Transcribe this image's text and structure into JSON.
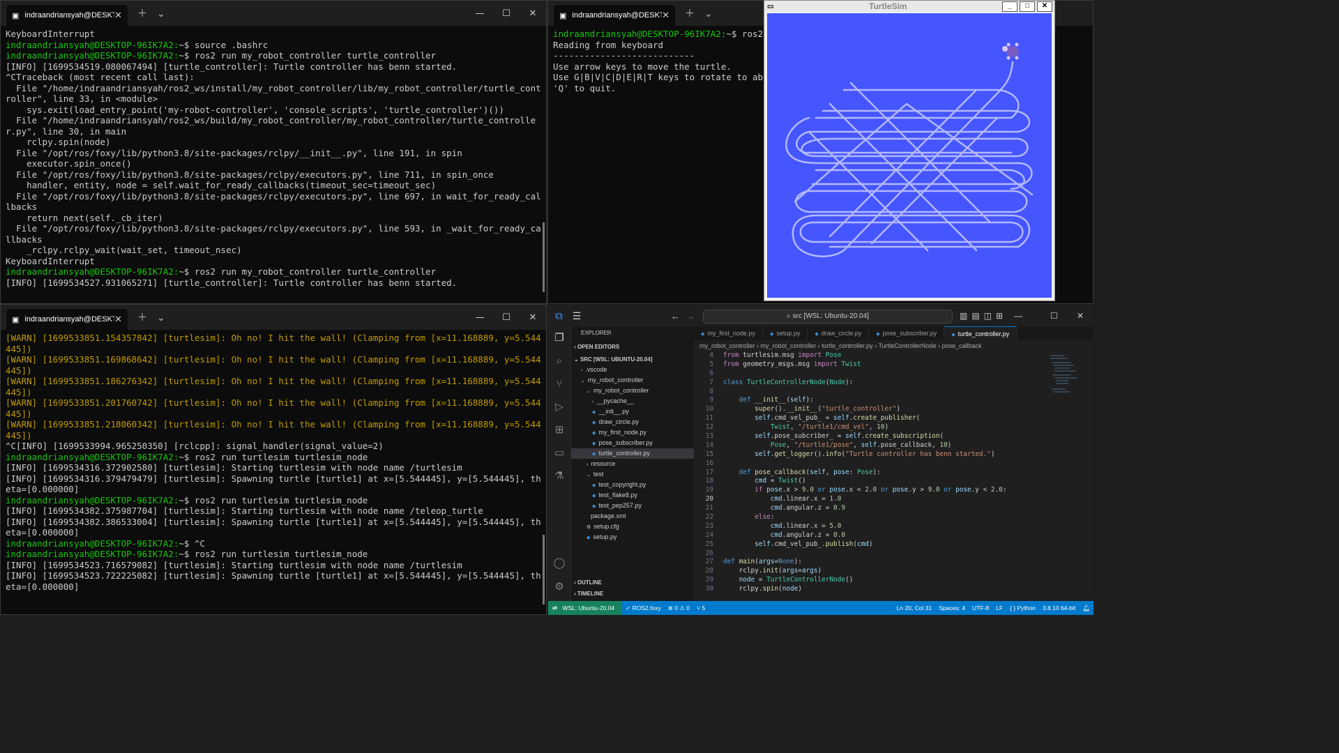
{
  "term_tl": {
    "tab_title": "indraandriansyah@DESKTOP-",
    "lines": [
      {
        "t": "KeyboardInterrupt",
        "c": "w"
      },
      {
        "parts": [
          {
            "t": "indraandriansyah@DESKTOP-96IK7A2:",
            "c": "g"
          },
          {
            "t": "~$ source .bashrc",
            "c": "w"
          }
        ]
      },
      {
        "parts": [
          {
            "t": "indraandriansyah@DESKTOP-96IK7A2:",
            "c": "g"
          },
          {
            "t": "~$ ros2 run my_robot_controller turtle_controller",
            "c": "w"
          }
        ]
      },
      {
        "t": "[INFO] [1699534519.080067494] [turtle_controller]: Turtle controller has benn started.",
        "c": "w"
      },
      {
        "t": "^CTraceback (most recent call last):",
        "c": "w"
      },
      {
        "t": "  File \"/home/indraandriansyah/ros2_ws/install/my_robot_controller/lib/my_robot_controller/turtle_controller\", line 33, in <module>",
        "c": "w"
      },
      {
        "t": "    sys.exit(load_entry_point('my-robot-controller', 'console_scripts', 'turtle_controller')())",
        "c": "w"
      },
      {
        "t": "  File \"/home/indraandriansyah/ros2_ws/build/my_robot_controller/my_robot_controller/turtle_controller.py\", line 30, in main",
        "c": "w"
      },
      {
        "t": "    rclpy.spin(node)",
        "c": "w"
      },
      {
        "t": "  File \"/opt/ros/foxy/lib/python3.8/site-packages/rclpy/__init__.py\", line 191, in spin",
        "c": "w"
      },
      {
        "t": "    executor.spin_once()",
        "c": "w"
      },
      {
        "t": "  File \"/opt/ros/foxy/lib/python3.8/site-packages/rclpy/executors.py\", line 711, in spin_once",
        "c": "w"
      },
      {
        "t": "    handler, entity, node = self.wait_for_ready_callbacks(timeout_sec=timeout_sec)",
        "c": "w"
      },
      {
        "t": "  File \"/opt/ros/foxy/lib/python3.8/site-packages/rclpy/executors.py\", line 697, in wait_for_ready_callbacks",
        "c": "w"
      },
      {
        "t": "    return next(self._cb_iter)",
        "c": "w"
      },
      {
        "t": "  File \"/opt/ros/foxy/lib/python3.8/site-packages/rclpy/executors.py\", line 593, in _wait_for_ready_callbacks",
        "c": "w"
      },
      {
        "t": "    _rclpy.rclpy_wait(wait_set, timeout_nsec)",
        "c": "w"
      },
      {
        "t": "KeyboardInterrupt",
        "c": "w"
      },
      {
        "parts": [
          {
            "t": "indraandriansyah@DESKTOP-96IK7A2:",
            "c": "g"
          },
          {
            "t": "~$ ros2 run my_robot_controller turtle_controller",
            "c": "w"
          }
        ]
      },
      {
        "t": "[INFO] [1699534527.931065271] [turtle_controller]: Turtle controller has benn started.",
        "c": "w"
      }
    ]
  },
  "term_tr": {
    "tab_title": "indraandriansyah@DESKTOP-",
    "lines": [
      {
        "parts": [
          {
            "t": "indraandriansyah@DESKTOP-96IK7A2:",
            "c": "g"
          },
          {
            "t": "~$ ros2 r",
            "c": "w"
          }
        ]
      },
      {
        "t": "Reading from keyboard",
        "c": "w"
      },
      {
        "t": "---------------------------",
        "c": "w"
      },
      {
        "t": "Use arrow keys to move the turtle.",
        "c": "w"
      },
      {
        "t": "Use G|B|V|C|D|E|R|T keys to rotate to abso",
        "c": "w"
      },
      {
        "t": "'Q' to quit.",
        "c": "w"
      }
    ]
  },
  "term_bl": {
    "tab_title": "indraandriansyah@DESKTOP-",
    "lines": [
      {
        "t": "[WARN] [1699533851.154357842] [turtlesim]: Oh no! I hit the wall! (Clamping from [x=11.168889, y=5.544445])",
        "c": "y"
      },
      {
        "t": "[WARN] [1699533851.169868642] [turtlesim]: Oh no! I hit the wall! (Clamping from [x=11.168889, y=5.544445])",
        "c": "y"
      },
      {
        "t": "[WARN] [1699533851.186276342] [turtlesim]: Oh no! I hit the wall! (Clamping from [x=11.168889, y=5.544445])",
        "c": "y"
      },
      {
        "t": "[WARN] [1699533851.201760742] [turtlesim]: Oh no! I hit the wall! (Clamping from [x=11.168889, y=5.544445])",
        "c": "y"
      },
      {
        "t": "[WARN] [1699533851.218060342] [turtlesim]: Oh no! I hit the wall! (Clamping from [x=11.168889, y=5.544445])",
        "c": "y"
      },
      {
        "t": "^C[INFO] [1699533994.965250350] [rclcpp]: signal_handler(signal_value=2)",
        "c": "w"
      },
      {
        "parts": [
          {
            "t": "indraandriansyah@DESKTOP-96IK7A2:",
            "c": "g"
          },
          {
            "t": "~$ ros2 run turtlesim turtlesim_node",
            "c": "w"
          }
        ]
      },
      {
        "t": "[INFO] [1699534316.372902580] [turtlesim]: Starting turtlesim with node name /turtlesim",
        "c": "w"
      },
      {
        "t": "[INFO] [1699534316.379479479] [turtlesim]: Spawning turtle [turtle1] at x=[5.544445], y=[5.544445], theta=[0.000000]",
        "c": "w"
      },
      {
        "parts": [
          {
            "t": "indraandriansyah@DESKTOP-96IK7A2:",
            "c": "g"
          },
          {
            "t": "~$ ros2 run turtlesim turtlesim_node",
            "c": "w"
          }
        ]
      },
      {
        "t": "[INFO] [1699534382.375987704] [turtlesim]: Starting turtlesim with node name /teleop_turtle",
        "c": "w"
      },
      {
        "t": "[INFO] [1699534382.386533004] [turtlesim]: Spawning turtle [turtle1] at x=[5.544445], y=[5.544445], theta=[0.000000]",
        "c": "w"
      },
      {
        "parts": [
          {
            "t": "indraandriansyah@DESKTOP-96IK7A2:",
            "c": "g"
          },
          {
            "t": "~$ ^C",
            "c": "w"
          }
        ]
      },
      {
        "parts": [
          {
            "t": "indraandriansyah@DESKTOP-96IK7A2:",
            "c": "g"
          },
          {
            "t": "~$ ros2 run turtlesim turtlesim_node",
            "c": "w"
          }
        ]
      },
      {
        "t": "[INFO] [1699534523.716579082] [turtlesim]: Starting turtlesim with node name /turtlesim",
        "c": "w"
      },
      {
        "t": "[INFO] [1699534523.722225082] [turtlesim]: Spawning turtle [turtle1] at x=[5.544445], y=[5.544445], theta=[0.000000]",
        "c": "w"
      }
    ]
  },
  "turtlesim": {
    "title": "TurtleSim",
    "bg_color": "#4556ff",
    "path_color": "#b3b8ff"
  },
  "vscode": {
    "search": "src [WSL: Ubuntu-20.04]",
    "explorer_title": "EXPLORER",
    "open_editors": "OPEN EDITORS",
    "root": "SRC [WSL: UBUNTU-20.04]",
    "tree": [
      {
        "label": ".vscode",
        "indent": 1,
        "icon": "›"
      },
      {
        "label": "my_robot_controller",
        "indent": 1,
        "icon": "⌄"
      },
      {
        "label": "my_robot_controller",
        "indent": 2,
        "icon": "⌄"
      },
      {
        "label": "__pycache__",
        "indent": 3,
        "icon": "›"
      },
      {
        "label": "__init__.py",
        "indent": 3,
        "icon": "◆"
      },
      {
        "label": "draw_circle.py",
        "indent": 3,
        "icon": "◆"
      },
      {
        "label": "my_first_node.py",
        "indent": 3,
        "icon": "◆"
      },
      {
        "label": "pose_subscriber.py",
        "indent": 3,
        "icon": "◆"
      },
      {
        "label": "turtle_controller.py",
        "indent": 3,
        "icon": "◆",
        "selected": true
      },
      {
        "label": "resource",
        "indent": 2,
        "icon": "›"
      },
      {
        "label": "test",
        "indent": 2,
        "icon": "⌄"
      },
      {
        "label": "test_copyright.py",
        "indent": 3,
        "icon": "◆"
      },
      {
        "label": "test_flake8.py",
        "indent": 3,
        "icon": "◆"
      },
      {
        "label": "test_pep257.py",
        "indent": 3,
        "icon": "◆"
      },
      {
        "label": "package.xml",
        "indent": 2,
        "icon": " "
      },
      {
        "label": "setup.cfg",
        "indent": 2,
        "icon": "⚙"
      },
      {
        "label": "setup.py",
        "indent": 2,
        "icon": "◆"
      }
    ],
    "outline": "OUTLINE",
    "timeline": "TIMELINE",
    "tabs": [
      {
        "label": "my_first_node.py"
      },
      {
        "label": "setup.py"
      },
      {
        "label": "draw_circle.py"
      },
      {
        "label": "pose_subscriber.py"
      },
      {
        "label": "turtle_controller.py",
        "active": true
      }
    ],
    "breadcrumbs": "my_robot_controller › my_robot_controller › turtle_controller.py › TurtleControllerNode › pose_callback",
    "code": [
      {
        "n": "4",
        "s": [
          [
            "from ",
            "kc"
          ],
          [
            "turtlesim.msg ",
            "pl"
          ],
          [
            "import ",
            "kc"
          ],
          [
            "Pose",
            "cls"
          ]
        ]
      },
      {
        "n": "5",
        "s": [
          [
            "from ",
            "kc"
          ],
          [
            "geometry_msgs.msg ",
            "pl"
          ],
          [
            "import ",
            "kc"
          ],
          [
            "Twist",
            "cls"
          ]
        ]
      },
      {
        "n": "6",
        "s": []
      },
      {
        "n": "7",
        "s": [
          [
            "class ",
            "kw"
          ],
          [
            "TurtleControllerNode",
            "cls"
          ],
          [
            "(",
            "pl"
          ],
          [
            "Node",
            "cls"
          ],
          [
            "):",
            "pl"
          ]
        ]
      },
      {
        "n": "8",
        "s": []
      },
      {
        "n": "9",
        "s": [
          [
            "    def ",
            "kw"
          ],
          [
            "__init__",
            "fn"
          ],
          [
            "(",
            "pl"
          ],
          [
            "self",
            "vr"
          ],
          [
            "):",
            "pl"
          ]
        ]
      },
      {
        "n": "10",
        "s": [
          [
            "        super",
            "fn"
          ],
          [
            "().",
            "pl"
          ],
          [
            "__init__",
            "fn"
          ],
          [
            "(",
            "pl"
          ],
          [
            "\"turtle_controller\"",
            "st"
          ],
          [
            ")",
            "pl"
          ]
        ]
      },
      {
        "n": "11",
        "s": [
          [
            "        self",
            "vr"
          ],
          [
            ".cmd_vel_pub_ = ",
            "pl"
          ],
          [
            "self",
            "vr"
          ],
          [
            ".",
            "pl"
          ],
          [
            "create_publisher",
            "fn"
          ],
          [
            "(",
            "pl"
          ]
        ]
      },
      {
        "n": "12",
        "s": [
          [
            "            Twist",
            "cls"
          ],
          [
            ", ",
            "pl"
          ],
          [
            "\"/turtle1/cmd_vel\"",
            "st"
          ],
          [
            ", ",
            "pl"
          ],
          [
            "10",
            "nm"
          ],
          [
            ")",
            "pl"
          ]
        ]
      },
      {
        "n": "13",
        "s": [
          [
            "        self",
            "vr"
          ],
          [
            ".pose_subcriber_ = ",
            "pl"
          ],
          [
            "self",
            "vr"
          ],
          [
            ".",
            "pl"
          ],
          [
            "create_subscription",
            "fn"
          ],
          [
            "(",
            "pl"
          ]
        ]
      },
      {
        "n": "14",
        "s": [
          [
            "            Pose",
            "cls"
          ],
          [
            ", ",
            "pl"
          ],
          [
            "\"/turtle1/pose\"",
            "st"
          ],
          [
            ", ",
            "pl"
          ],
          [
            "self",
            "vr"
          ],
          [
            ".pose_callback, ",
            "pl"
          ],
          [
            "10",
            "nm"
          ],
          [
            ")",
            "pl"
          ]
        ]
      },
      {
        "n": "15",
        "s": [
          [
            "        self",
            "vr"
          ],
          [
            ".",
            "pl"
          ],
          [
            "get_logger",
            "fn"
          ],
          [
            "().",
            "pl"
          ],
          [
            "info",
            "fn"
          ],
          [
            "(",
            "pl"
          ],
          [
            "\"Turtle controller has benn started.\"",
            "st"
          ],
          [
            ")",
            "pl"
          ]
        ]
      },
      {
        "n": "16",
        "s": []
      },
      {
        "n": "17",
        "s": [
          [
            "    def ",
            "kw"
          ],
          [
            "pose_callback",
            "fn"
          ],
          [
            "(",
            "pl"
          ],
          [
            "self",
            "vr"
          ],
          [
            ", ",
            "pl"
          ],
          [
            "pose",
            "vr"
          ],
          [
            ": ",
            "pl"
          ],
          [
            "Pose",
            "cls"
          ],
          [
            "):",
            "pl"
          ]
        ]
      },
      {
        "n": "18",
        "s": [
          [
            "        cmd",
            "vr"
          ],
          [
            " = ",
            "pl"
          ],
          [
            "Twist",
            "cls"
          ],
          [
            "()",
            "pl"
          ]
        ]
      },
      {
        "n": "19",
        "s": [
          [
            "        if ",
            "kc"
          ],
          [
            "pose",
            "vr"
          ],
          [
            ".x > ",
            "pl"
          ],
          [
            "9.0",
            "nm"
          ],
          [
            " or ",
            "kw"
          ],
          [
            "pose",
            "vr"
          ],
          [
            ".x < ",
            "pl"
          ],
          [
            "2.0",
            "nm"
          ],
          [
            " or ",
            "kw"
          ],
          [
            "pose",
            "vr"
          ],
          [
            ".y > ",
            "pl"
          ],
          [
            "9.0",
            "nm"
          ],
          [
            " or ",
            "kw"
          ],
          [
            "pose",
            "vr"
          ],
          [
            ".y < ",
            "pl"
          ],
          [
            "2.0",
            "nm"
          ],
          [
            ":",
            "pl"
          ]
        ]
      },
      {
        "n": "20",
        "s": [
          [
            "            cmd",
            "vr"
          ],
          [
            ".linear.x = ",
            "pl"
          ],
          [
            "1.0",
            "nm"
          ]
        ]
      },
      {
        "n": "21",
        "s": [
          [
            "            cmd",
            "vr"
          ],
          [
            ".angular.z = ",
            "pl"
          ],
          [
            "0.9",
            "nm"
          ]
        ]
      },
      {
        "n": "22",
        "s": [
          [
            "        else",
            "kc"
          ],
          [
            ":",
            "pl"
          ]
        ]
      },
      {
        "n": "23",
        "s": [
          [
            "            cmd",
            "vr"
          ],
          [
            ".linear.x = ",
            "pl"
          ],
          [
            "5.0",
            "nm"
          ]
        ]
      },
      {
        "n": "24",
        "s": [
          [
            "            cmd",
            "vr"
          ],
          [
            ".angular.z = ",
            "pl"
          ],
          [
            "0.0",
            "nm"
          ]
        ]
      },
      {
        "n": "25",
        "s": [
          [
            "        self",
            "vr"
          ],
          [
            ".cmd_vel_pub_.",
            "pl"
          ],
          [
            "publish",
            "fn"
          ],
          [
            "(",
            "pl"
          ],
          [
            "cmd",
            "vr"
          ],
          [
            ")",
            "pl"
          ]
        ]
      },
      {
        "n": "26",
        "s": []
      },
      {
        "n": "27",
        "s": [
          [
            "def ",
            "kw"
          ],
          [
            "main",
            "fn"
          ],
          [
            "(",
            "pl"
          ],
          [
            "args",
            "vr"
          ],
          [
            "=",
            "pl"
          ],
          [
            "None",
            "kw"
          ],
          [
            "):",
            "pl"
          ]
        ]
      },
      {
        "n": "28",
        "s": [
          [
            "    rclpy",
            "pl"
          ],
          [
            ".",
            "pl"
          ],
          [
            "init",
            "fn"
          ],
          [
            "(",
            "pl"
          ],
          [
            "args",
            "vr"
          ],
          [
            "=",
            "pl"
          ],
          [
            "args",
            "vr"
          ],
          [
            ")",
            "pl"
          ]
        ]
      },
      {
        "n": "29",
        "s": [
          [
            "    node",
            "vr"
          ],
          [
            " = ",
            "pl"
          ],
          [
            "TurtleControllerNode",
            "cls"
          ],
          [
            "()",
            "pl"
          ]
        ]
      },
      {
        "n": "30",
        "s": [
          [
            "    rclpy",
            "pl"
          ],
          [
            ".",
            "pl"
          ],
          [
            "spin",
            "fn"
          ],
          [
            "(",
            "pl"
          ],
          [
            "node",
            "vr"
          ],
          [
            ")",
            "pl"
          ]
        ]
      }
    ],
    "status": {
      "remote": "WSL: Ubuntu-20.04",
      "ros": "✓ ROS2.foxy",
      "problems": "⊗ 0 ⚠ 0",
      "ports": "⑂ 5",
      "position": "Ln 20, Col 31",
      "spaces": "Spaces: 4",
      "encoding": "UTF-8",
      "eol": "LF",
      "lang": "{ } Python",
      "interp": "3.8.10 64-bit"
    }
  }
}
